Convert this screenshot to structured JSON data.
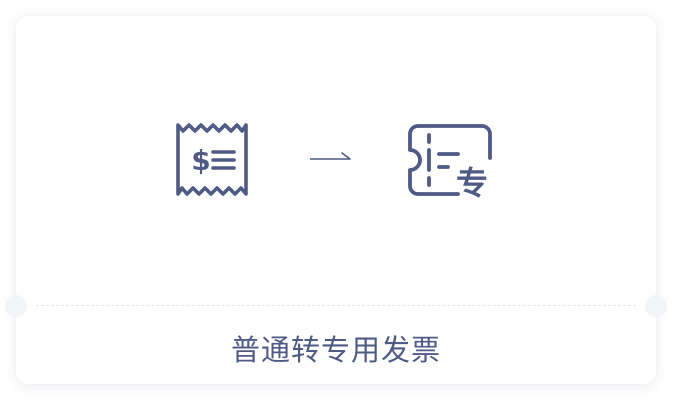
{
  "card": {
    "caption": "普通转专用发票"
  },
  "icons": {
    "source": "receipt-dollar-icon",
    "arrow": "right-arrow-icon",
    "target": "ticket-special-icon"
  },
  "colors": {
    "accent": "#4f5a85",
    "divider": "#e3e5ec",
    "background": "#ffffff"
  }
}
